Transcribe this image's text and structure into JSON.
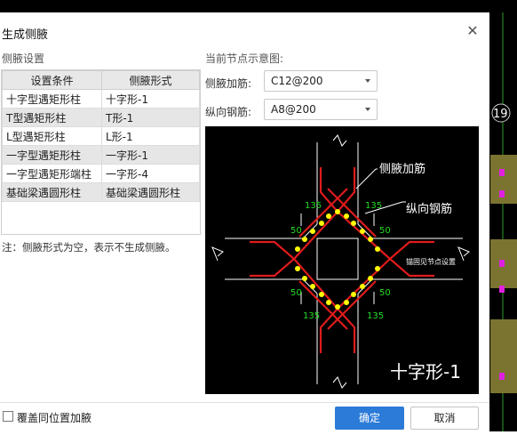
{
  "dialog": {
    "title": "生成侧腋",
    "close_glyph": "✕"
  },
  "settings": {
    "section_label": "侧腋设置",
    "note": "注：侧腋形式为空，表示不生成侧腋。"
  },
  "table": {
    "headers": [
      "设置条件",
      "侧腋形式"
    ],
    "rows": [
      [
        "十字型遇矩形柱",
        "十字形-1"
      ],
      [
        "T型遇矩形柱",
        "T形-1"
      ],
      [
        "L型遇矩形柱",
        "L形-1"
      ],
      [
        "一字型遇矩形柱",
        "一字形-1"
      ],
      [
        "一字型遇矩形端柱",
        "一字形-4"
      ],
      [
        "基础梁遇圆形柱",
        "基础梁遇圆形柱"
      ]
    ]
  },
  "preview": {
    "label": "当前节点示意图:",
    "haunch_rebar_label": "侧腋加筋:",
    "haunch_rebar_value": "C12@200",
    "long_rebar_label": "纵向钢筋:",
    "long_rebar_value": "A8@200",
    "diagram": {
      "callout_haunch": "侧腋加筋",
      "callout_long": "纵向钢筋",
      "dim_135": "135",
      "dim_50": "50",
      "side_note": "锚固见节点设置",
      "shape_name": "十字形-1"
    }
  },
  "footer": {
    "overwrite_label": "覆盖同位置加腋",
    "ok": "确定",
    "cancel": "取消"
  },
  "background": {
    "axis_label": "19"
  },
  "colors": {
    "rebar": "#e01b1b",
    "bar_dot": "#ffff00",
    "dim_text": "#22dd22",
    "accent": "#2c7bd8"
  }
}
